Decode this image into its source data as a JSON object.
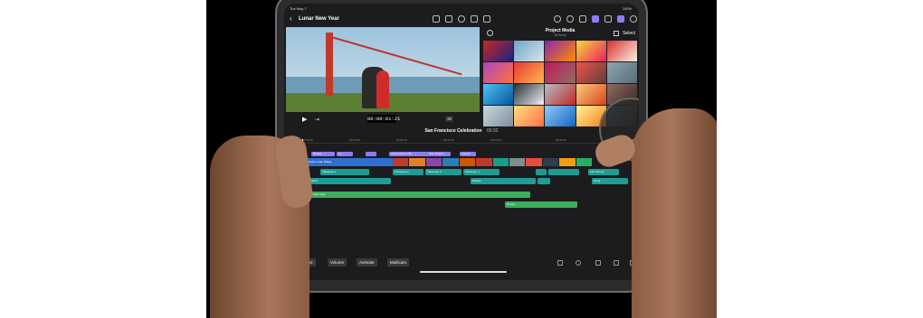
{
  "statusbar": {
    "time": "9:41 AM",
    "day": "Tue May 7",
    "battery": "100%"
  },
  "toolbar": {
    "back": "‹",
    "project_title": "Lunar New Year"
  },
  "viewer": {
    "timecode": "00:00:01:21",
    "zoom": "38"
  },
  "browser": {
    "title": "Project Media",
    "subtitle": "28 Items",
    "select_label": "Select"
  },
  "timeline": {
    "title": "San Francisco Celebration",
    "duration": "00:32"
  },
  "ruler_ticks": [
    "00:00:00",
    "00:00:05",
    "00:00:10",
    "00:00:15",
    "00:00:20",
    "00:00:25"
  ],
  "clips": {
    "title1": "Streets",
    "title2": "Lu",
    "title3": "Aerial View of SF",
    "title4": "Solo Dragon",
    "title5": "Sunset",
    "video1": "Golden Gate Bridge",
    "audio1": "Voiceover 1",
    "audio2": "Voiceover 2",
    "audio3": "Voiceover 3",
    "audio4": "Voiceover 4",
    "audio5": "Ambiance",
    "audio6": "Fire Flames",
    "audio7": "Dragon",
    "audio8": "Footsteps",
    "audio9": "Gong",
    "music1": "Lunar New Year",
    "music2": "Crowd"
  },
  "bottombar": {
    "inspect": "Inspect",
    "volume": "Volume",
    "animate": "Animate",
    "multicam": "Multicam"
  },
  "colors": {
    "accent": "#8b7cf6",
    "video": "#2f6fd0",
    "audio": "#1e9c94",
    "music": "#3cae5c",
    "jog_accent": "#c6e23c"
  }
}
